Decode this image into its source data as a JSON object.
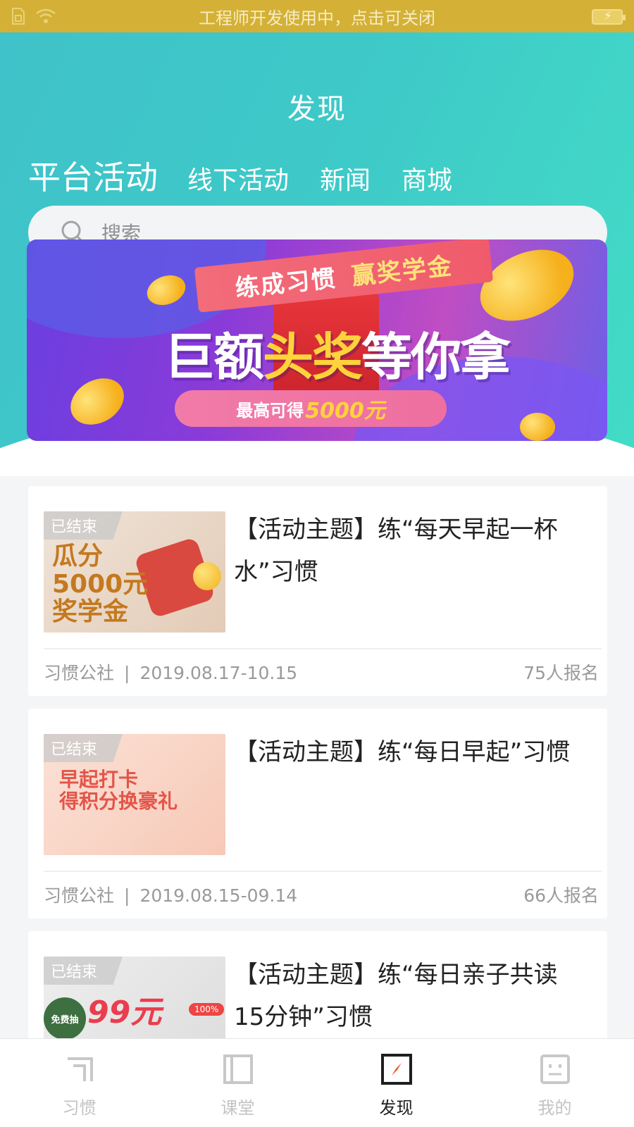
{
  "status_bar": {
    "message": "工程师开发使用中，点击可关闭",
    "icons": [
      "sim-icon",
      "wifi-icon",
      "battery-icon"
    ]
  },
  "header": {
    "title": "发现"
  },
  "tabs": [
    {
      "label": "平台活动",
      "active": true
    },
    {
      "label": "线下活动",
      "active": false
    },
    {
      "label": "新闻",
      "active": false
    },
    {
      "label": "商城",
      "active": false
    }
  ],
  "search": {
    "placeholder": "搜索"
  },
  "banner": {
    "ribbon_left": "练成习惯",
    "ribbon_right": "赢奖学金",
    "slogan_a": "巨额",
    "slogan_b": "头奖",
    "slogan_c": "等你拿",
    "sub_text": "最高可得",
    "sub_amount": "5000元"
  },
  "activities": [
    {
      "status": "已结束",
      "thumb_text": "瓜分\n5000元\n奖学金",
      "title": "【活动主题】练“每天早起一杯水”习惯",
      "publisher": "习惯公社",
      "separator": "|",
      "dates": "2019.08.17-10.15",
      "signups": "75人报名"
    },
    {
      "status": "已结束",
      "thumb_text": "早起打卡\n得积分换豪礼",
      "title": "【活动主题】练“每日早起”习惯",
      "publisher": "习惯公社",
      "separator": "|",
      "dates": "2019.08.15-09.14",
      "signups": "66人报名"
    },
    {
      "status": "已结束",
      "thumb_text": "99元",
      "thumb_badge": "免费抽",
      "thumb_note": "100%",
      "title": "【活动主题】练“每日亲子共读15分钟”习惯"
    }
  ],
  "bottom_nav": [
    {
      "label": "习惯",
      "icon": "habit-icon",
      "active": false
    },
    {
      "label": "课堂",
      "icon": "classroom-icon",
      "active": false
    },
    {
      "label": "发现",
      "icon": "compass-icon",
      "active": true
    },
    {
      "label": "我的",
      "icon": "profile-face-icon",
      "active": false
    }
  ],
  "colors": {
    "status_bar": "#d4b136",
    "header_gradient_start": "#3fc2c9",
    "header_gradient_end": "#43dcc6",
    "nav_active": "#222222",
    "nav_inactive": "#c3c3c3"
  }
}
